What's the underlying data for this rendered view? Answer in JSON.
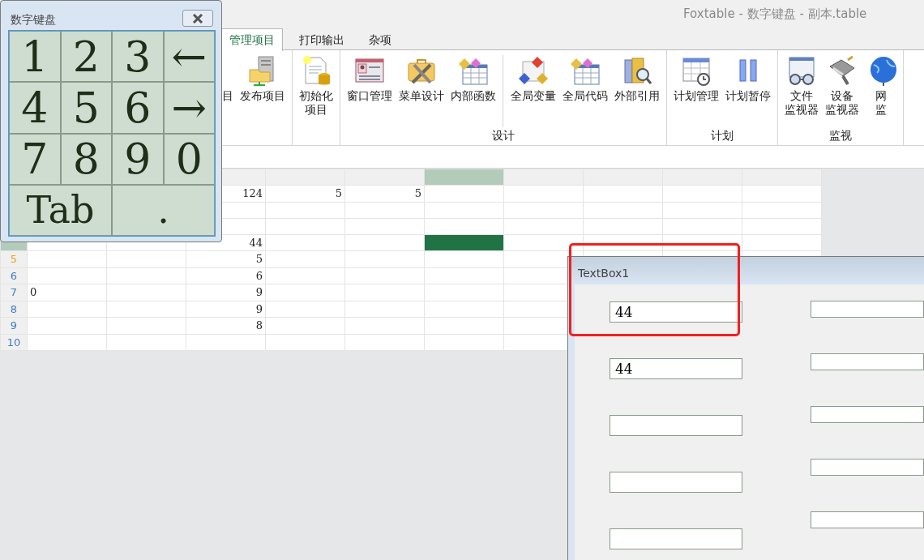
{
  "window": {
    "title": "Foxtable - 数字键盘 - 副本.table"
  },
  "tabs": [
    {
      "label": "管理项目",
      "selected": true
    },
    {
      "label": "打印输出",
      "selected": false
    },
    {
      "label": "杂项",
      "selected": false
    }
  ],
  "ribbon": {
    "groups": [
      {
        "sections": [
          [
            {
              "lines": [
                "目"
              ],
              "kind": "cut"
            },
            {
              "lines": [
                "发布项目"
              ],
              "kind": "full"
            }
          ]
        ]
      },
      {
        "sections": [
          [
            {
              "lines": [
                "初始化",
                "项目"
              ],
              "kind": "full"
            }
          ]
        ]
      },
      {
        "label": "设计",
        "sections": [
          [
            {
              "lines": [
                "窗口管理"
              ],
              "kind": "full"
            },
            {
              "lines": [
                "菜单设计"
              ],
              "kind": "full"
            },
            {
              "lines": [
                "内部函数"
              ],
              "kind": "full"
            }
          ],
          [
            {
              "lines": [
                "全局变量"
              ],
              "kind": "full"
            },
            {
              "lines": [
                "全局代码"
              ],
              "kind": "full"
            },
            {
              "lines": [
                "外部引用"
              ],
              "kind": "full"
            }
          ]
        ]
      },
      {
        "label": "计划",
        "sections": [
          [
            {
              "lines": [
                "计划管理"
              ],
              "kind": "full"
            },
            {
              "lines": [
                "计划暂停"
              ],
              "kind": "full"
            }
          ]
        ]
      },
      {
        "label": "监视",
        "sections": [
          [
            {
              "lines": [
                "文件",
                "监视器"
              ],
              "kind": "full"
            },
            {
              "lines": [
                "设备",
                "监视器"
              ],
              "kind": "full"
            },
            {
              "lines": [
                "网",
                "监"
              ],
              "kind": "full"
            }
          ]
        ]
      }
    ]
  },
  "table": {
    "columns": [
      {},
      {},
      {
        "selected": false
      },
      {
        "selected": false
      },
      {
        "selected": false
      },
      {
        "selected": true
      },
      {
        "selected": false
      },
      {
        "selected": false
      },
      {
        "selected": false
      },
      {
        "selected": false
      }
    ],
    "rows": [
      {
        "cells": [
          null,
          null,
          "124",
          "5",
          "5",
          null,
          null,
          null,
          null,
          null
        ]
      },
      {
        "cells": [
          null,
          null,
          null,
          null,
          null,
          null,
          null,
          null,
          null,
          null
        ]
      },
      {
        "cells": [
          null,
          null,
          null,
          null,
          null,
          null,
          null,
          null,
          null,
          null
        ]
      },
      {
        "selected": true,
        "cells": [
          null,
          null,
          "44",
          null,
          null,
          null,
          null,
          null,
          null,
          null
        ]
      },
      {
        "number": "5",
        "color": "#f0a020",
        "selected": false,
        "cells": [
          null,
          null,
          "5",
          null,
          null,
          null,
          null,
          null,
          null,
          null
        ]
      },
      {
        "number": "6",
        "color": "#3d7fc4",
        "selected": false,
        "cells": [
          null,
          null,
          "6",
          null,
          null,
          null,
          null,
          null,
          null,
          null
        ]
      },
      {
        "number": "7",
        "color": "#3d7fc4",
        "selected": false,
        "cells": [
          "0",
          null,
          "9",
          null,
          null,
          null,
          null,
          null,
          null,
          null
        ]
      },
      {
        "number": "8",
        "color": "#3d7fc4",
        "selected": false,
        "cells": [
          null,
          null,
          "9",
          null,
          null,
          null,
          null,
          null,
          null,
          null
        ]
      },
      {
        "number": "9",
        "color": "#3d7fc4",
        "selected": false,
        "cells": [
          null,
          null,
          "8",
          null,
          null,
          null,
          null,
          null,
          null,
          null
        ]
      },
      {
        "number": "10",
        "color": "#3d7fc4",
        "selected": false,
        "cells": [
          null,
          null,
          null,
          null,
          null,
          null,
          null,
          null,
          null,
          null
        ]
      }
    ]
  },
  "keypad": {
    "title": "数字键盘",
    "keys": [
      {
        "label": "1",
        "kind": "normal"
      },
      {
        "label": "2",
        "kind": "normal"
      },
      {
        "label": "3",
        "kind": "normal"
      },
      {
        "label": "←",
        "kind": "normal"
      },
      {
        "label": "4",
        "kind": "normal"
      },
      {
        "label": "5",
        "kind": "normal"
      },
      {
        "label": "6",
        "kind": "normal"
      },
      {
        "label": "→",
        "kind": "normal"
      },
      {
        "label": "7",
        "kind": "normal"
      },
      {
        "label": "8",
        "kind": "normal"
      },
      {
        "label": "9",
        "kind": "normal"
      },
      {
        "label": "0",
        "kind": "normal"
      },
      {
        "label": "Tab",
        "kind": "wide"
      },
      {
        "label": ".",
        "kind": "wide"
      }
    ]
  },
  "form": {
    "title": "TextBox1",
    "highlighted": true,
    "left_fields": [
      {
        "kind": "box",
        "value": "44"
      },
      {
        "kind": "box",
        "value": "44"
      },
      {
        "kind": "box"
      },
      {
        "kind": "box"
      },
      {
        "kind": "box"
      }
    ],
    "right_fields": [
      {
        "kind": "box"
      },
      {
        "kind": "box"
      },
      {
        "kind": "box"
      },
      {
        "kind": "box"
      },
      {
        "kind": "box"
      }
    ]
  }
}
